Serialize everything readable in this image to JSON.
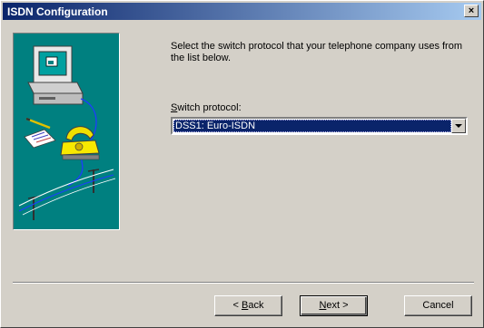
{
  "window": {
    "title": "ISDN Configuration",
    "close_glyph": "×"
  },
  "content": {
    "instructions": "Select the switch protocol that your telephone company uses from the list below.",
    "switch_label_accel": "S",
    "switch_label_rest": "witch protocol:",
    "switch_value": "DSS1: Euro-ISDN"
  },
  "buttons": {
    "back_prefix": "< ",
    "back_accel": "B",
    "back_rest": "ack",
    "next_accel": "N",
    "next_rest": "ext >",
    "cancel": "Cancel"
  },
  "icons": {
    "illustration": "computer-telephone-isdn-illustration",
    "combo_arrow": "chevron-down-icon",
    "close": "close-icon"
  },
  "colors": {
    "titlebar_start": "#0a246a",
    "titlebar_end": "#a6caf0",
    "illustration_bg": "#008080",
    "selection": "#0a246a"
  }
}
